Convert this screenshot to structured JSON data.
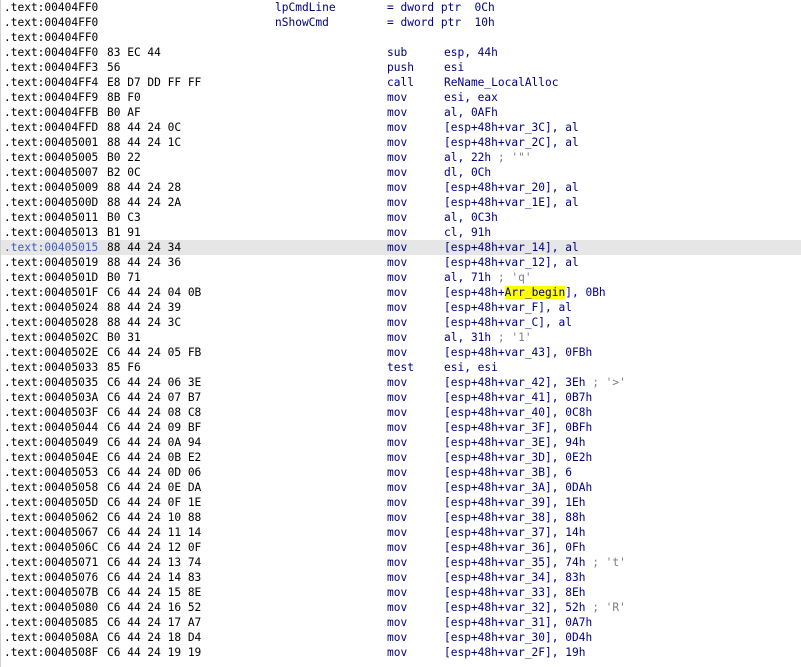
{
  "colors": {
    "background": "#ffffff",
    "selected_line": "#e6e6e6",
    "highlight": "#ffff00",
    "code_text": "#000080",
    "comment_text": "#7f7f7f"
  },
  "header_lines": [
    {
      "address": ".text:00404FF0",
      "var_name": "lpCmdLine",
      "definition": "= dword ptr  0Ch"
    },
    {
      "address": ".text:00404FF0",
      "var_name": "nShowCmd",
      "definition": "= dword ptr  10h"
    },
    {
      "address": ".text:00404FF0",
      "var_name": "",
      "definition": ""
    }
  ],
  "instructions": [
    {
      "address": ".text:00404FF0",
      "bytes": "83 EC 44",
      "mnemonic": "sub",
      "operands": "esp, 44h",
      "comment": ""
    },
    {
      "address": ".text:00404FF3",
      "bytes": "56",
      "mnemonic": "push",
      "operands": "esi",
      "comment": ""
    },
    {
      "address": ".text:00404FF4",
      "bytes": "E8 D7 DD FF FF",
      "mnemonic": "call",
      "operands": "ReName_LocalAlloc",
      "comment": ""
    },
    {
      "address": ".text:00404FF9",
      "bytes": "8B F0",
      "mnemonic": "mov",
      "operands": "esi, eax",
      "comment": ""
    },
    {
      "address": ".text:00404FFB",
      "bytes": "B0 AF",
      "mnemonic": "mov",
      "operands": "al, 0AFh",
      "comment": ""
    },
    {
      "address": ".text:00404FFD",
      "bytes": "88 44 24 0C",
      "mnemonic": "mov",
      "operands": "[esp+48h+var_3C], al",
      "comment": ""
    },
    {
      "address": ".text:00405001",
      "bytes": "88 44 24 1C",
      "mnemonic": "mov",
      "operands": "[esp+48h+var_2C], al",
      "comment": ""
    },
    {
      "address": ".text:00405005",
      "bytes": "B0 22",
      "mnemonic": "mov",
      "operands": "al, 22h",
      "comment": " ; '\"'"
    },
    {
      "address": ".text:00405007",
      "bytes": "B2 0C",
      "mnemonic": "mov",
      "operands": "dl, 0Ch",
      "comment": ""
    },
    {
      "address": ".text:00405009",
      "bytes": "88 44 24 28",
      "mnemonic": "mov",
      "operands": "[esp+48h+var_20], al",
      "comment": ""
    },
    {
      "address": ".text:0040500D",
      "bytes": "88 44 24 2A",
      "mnemonic": "mov",
      "operands": "[esp+48h+var_1E], al",
      "comment": ""
    },
    {
      "address": ".text:00405011",
      "bytes": "B0 C3",
      "mnemonic": "mov",
      "operands": "al, 0C3h",
      "comment": ""
    },
    {
      "address": ".text:00405013",
      "bytes": "B1 91",
      "mnemonic": "mov",
      "operands": "cl, 91h",
      "comment": ""
    },
    {
      "address": ".text:00405015",
      "bytes": "88 44 24 34",
      "mnemonic": "mov",
      "operands": "[esp+48h+var_14], al",
      "comment": "",
      "selected": true
    },
    {
      "address": ".text:00405019",
      "bytes": "88 44 24 36",
      "mnemonic": "mov",
      "operands": "[esp+48h+var_12], al",
      "comment": ""
    },
    {
      "address": ".text:0040501D",
      "bytes": "B0 71",
      "mnemonic": "mov",
      "operands": "al, 71h",
      "comment": " ; 'q'"
    },
    {
      "address": ".text:0040501F",
      "bytes": "C6 44 24 04 0B",
      "mnemonic": "mov",
      "operands_pre": "[esp+48h+",
      "operands_hl": "Arr_begin",
      "operands_post": "], 0Bh",
      "comment": ""
    },
    {
      "address": ".text:00405024",
      "bytes": "88 44 24 39",
      "mnemonic": "mov",
      "operands": "[esp+48h+var_F], al",
      "comment": ""
    },
    {
      "address": ".text:00405028",
      "bytes": "88 44 24 3C",
      "mnemonic": "mov",
      "operands": "[esp+48h+var_C], al",
      "comment": ""
    },
    {
      "address": ".text:0040502C",
      "bytes": "B0 31",
      "mnemonic": "mov",
      "operands": "al, 31h",
      "comment": " ; '1'"
    },
    {
      "address": ".text:0040502E",
      "bytes": "C6 44 24 05 FB",
      "mnemonic": "mov",
      "operands": "[esp+48h+var_43], 0FBh",
      "comment": ""
    },
    {
      "address": ".text:00405033",
      "bytes": "85 F6",
      "mnemonic": "test",
      "operands": "esi, esi",
      "comment": ""
    },
    {
      "address": ".text:00405035",
      "bytes": "C6 44 24 06 3E",
      "mnemonic": "mov",
      "operands": "[esp+48h+var_42], 3Eh",
      "comment": " ; '>'"
    },
    {
      "address": ".text:0040503A",
      "bytes": "C6 44 24 07 B7",
      "mnemonic": "mov",
      "operands": "[esp+48h+var_41], 0B7h",
      "comment": ""
    },
    {
      "address": ".text:0040503F",
      "bytes": "C6 44 24 08 C8",
      "mnemonic": "mov",
      "operands": "[esp+48h+var_40], 0C8h",
      "comment": ""
    },
    {
      "address": ".text:00405044",
      "bytes": "C6 44 24 09 BF",
      "mnemonic": "mov",
      "operands": "[esp+48h+var_3F], 0BFh",
      "comment": ""
    },
    {
      "address": ".text:00405049",
      "bytes": "C6 44 24 0A 94",
      "mnemonic": "mov",
      "operands": "[esp+48h+var_3E], 94h",
      "comment": ""
    },
    {
      "address": ".text:0040504E",
      "bytes": "C6 44 24 0B E2",
      "mnemonic": "mov",
      "operands": "[esp+48h+var_3D], 0E2h",
      "comment": ""
    },
    {
      "address": ".text:00405053",
      "bytes": "C6 44 24 0D 06",
      "mnemonic": "mov",
      "operands": "[esp+48h+var_3B], 6",
      "comment": ""
    },
    {
      "address": ".text:00405058",
      "bytes": "C6 44 24 0E DA",
      "mnemonic": "mov",
      "operands": "[esp+48h+var_3A], 0DAh",
      "comment": ""
    },
    {
      "address": ".text:0040505D",
      "bytes": "C6 44 24 0F 1E",
      "mnemonic": "mov",
      "operands": "[esp+48h+var_39], 1Eh",
      "comment": ""
    },
    {
      "address": ".text:00405062",
      "bytes": "C6 44 24 10 88",
      "mnemonic": "mov",
      "operands": "[esp+48h+var_38], 88h",
      "comment": ""
    },
    {
      "address": ".text:00405067",
      "bytes": "C6 44 24 11 14",
      "mnemonic": "mov",
      "operands": "[esp+48h+var_37], 14h",
      "comment": ""
    },
    {
      "address": ".text:0040506C",
      "bytes": "C6 44 24 12 0F",
      "mnemonic": "mov",
      "operands": "[esp+48h+var_36], 0Fh",
      "comment": ""
    },
    {
      "address": ".text:00405071",
      "bytes": "C6 44 24 13 74",
      "mnemonic": "mov",
      "operands": "[esp+48h+var_35], 74h",
      "comment": " ; 't'"
    },
    {
      "address": ".text:00405076",
      "bytes": "C6 44 24 14 83",
      "mnemonic": "mov",
      "operands": "[esp+48h+var_34], 83h",
      "comment": ""
    },
    {
      "address": ".text:0040507B",
      "bytes": "C6 44 24 15 8E",
      "mnemonic": "mov",
      "operands": "[esp+48h+var_33], 8Eh",
      "comment": ""
    },
    {
      "address": ".text:00405080",
      "bytes": "C6 44 24 16 52",
      "mnemonic": "mov",
      "operands": "[esp+48h+var_32], 52h",
      "comment": " ; 'R'"
    },
    {
      "address": ".text:00405085",
      "bytes": "C6 44 24 17 A7",
      "mnemonic": "mov",
      "operands": "[esp+48h+var_31], 0A7h",
      "comment": ""
    },
    {
      "address": ".text:0040508A",
      "bytes": "C6 44 24 18 D4",
      "mnemonic": "mov",
      "operands": "[esp+48h+var_30], 0D4h",
      "comment": ""
    },
    {
      "address": ".text:0040508F",
      "bytes": "C6 44 24 19 19",
      "mnemonic": "mov",
      "operands": "[esp+48h+var_2F], 19h",
      "comment": ""
    }
  ]
}
